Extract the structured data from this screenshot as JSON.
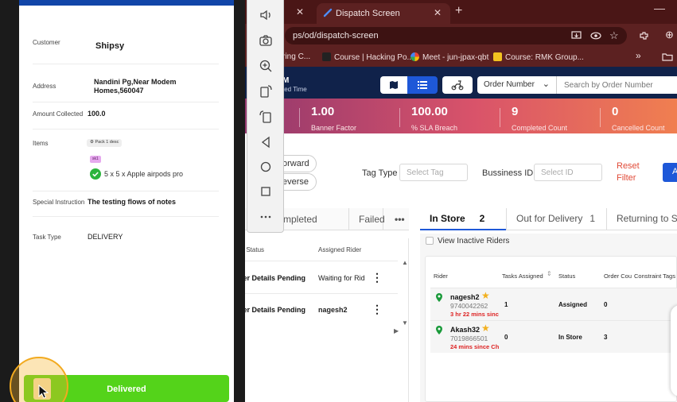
{
  "browser": {
    "active_tab_title": "Dispatch Screen",
    "url": "ps/od/dispatch-screen",
    "bookmarks": [
      {
        "label": "eering C...",
        "icon": "bookmark-icon"
      },
      {
        "label": "Course | Hacking Po...",
        "icon": "hackerrank-icon"
      },
      {
        "label": "Meet - jun-jpax-qbt",
        "icon": "google-meet-icon"
      },
      {
        "label": "Course: RMK Group...",
        "icon": "rmk-logo-icon"
      }
    ],
    "more_bookmarks": "»"
  },
  "app": {
    "brand_fragment": "M",
    "brand_sub": "ted Time",
    "order_select": "Order Number",
    "search_placeholder": "Search by Order Number"
  },
  "stats": [
    {
      "value": "1.00",
      "label": "Banner Factor"
    },
    {
      "value": "100.00",
      "label": "% SLA Breach"
    },
    {
      "value": "9",
      "label": "Completed Count"
    },
    {
      "value": "0",
      "label": "Cancelled Count"
    }
  ],
  "filters": {
    "forward_label": "orward",
    "reverse_label": "everse",
    "tag_type_label": "Tag Type",
    "tag_placeholder": "Select Tag",
    "business_id_label": "Bussiness ID",
    "id_placeholder": "Select ID",
    "reset_label_1": "Reset",
    "reset_label_2": "Filter",
    "apply_label": "A"
  },
  "status_tabs": {
    "completed": "mpleted",
    "failed": "Failed",
    "more": "•••"
  },
  "rider_tabs": [
    {
      "label": "In Store",
      "count": "2"
    },
    {
      "label": "Out for Delivery",
      "count": "1"
    },
    {
      "label": "Returning to St",
      "count": ""
    }
  ],
  "orders": {
    "col_status": "er Status",
    "col_rider": "Assigned Rider",
    "rows": [
      {
        "status": "der Details Pending",
        "rider": "Waiting for Rid"
      },
      {
        "status": "der Details Pending",
        "rider": "nagesh2"
      }
    ]
  },
  "riders": {
    "view_inactive": "View Inactive Riders",
    "columns": [
      "Rider",
      "Tasks Assigned",
      "Status",
      "Order Cou",
      "Constraint Tags"
    ],
    "rows": [
      {
        "name": "nagesh2",
        "phone": "9740042262",
        "since": "3 hr 22 mins sinc",
        "tasks": "1",
        "status": "Assigned",
        "orders": "0"
      },
      {
        "name": "Akash32",
        "phone": "7019866501",
        "since": "24 mins since Ch",
        "tasks": "0",
        "status": "In Store",
        "orders": "3"
      }
    ]
  },
  "phone": {
    "customer_label": "Customer",
    "customer_value": "Shipsy",
    "address_label": "Address",
    "address_value": "Nandini Pg,Near Modem Homes,560047",
    "amount_label": "Amount Collected",
    "amount_value": "100.0",
    "items_label": "Items",
    "pack_badge": "Pack 1 desc",
    "sku_badge": "sk1",
    "item_name": "5 x 5 x Apple airpods pro",
    "instruction_label": "Special Instruction",
    "instruction_value": "The testing flows of notes",
    "task_type_label": "Task Type",
    "task_type_value": "DELIVERY",
    "deliver_button": "Delivered"
  },
  "colors": {
    "tab_bar": "#4a1616",
    "app_header": "#10224a",
    "primary_blue": "#1e58d8",
    "delivered_green": "#54d31a",
    "reset_red": "#e14b38"
  }
}
